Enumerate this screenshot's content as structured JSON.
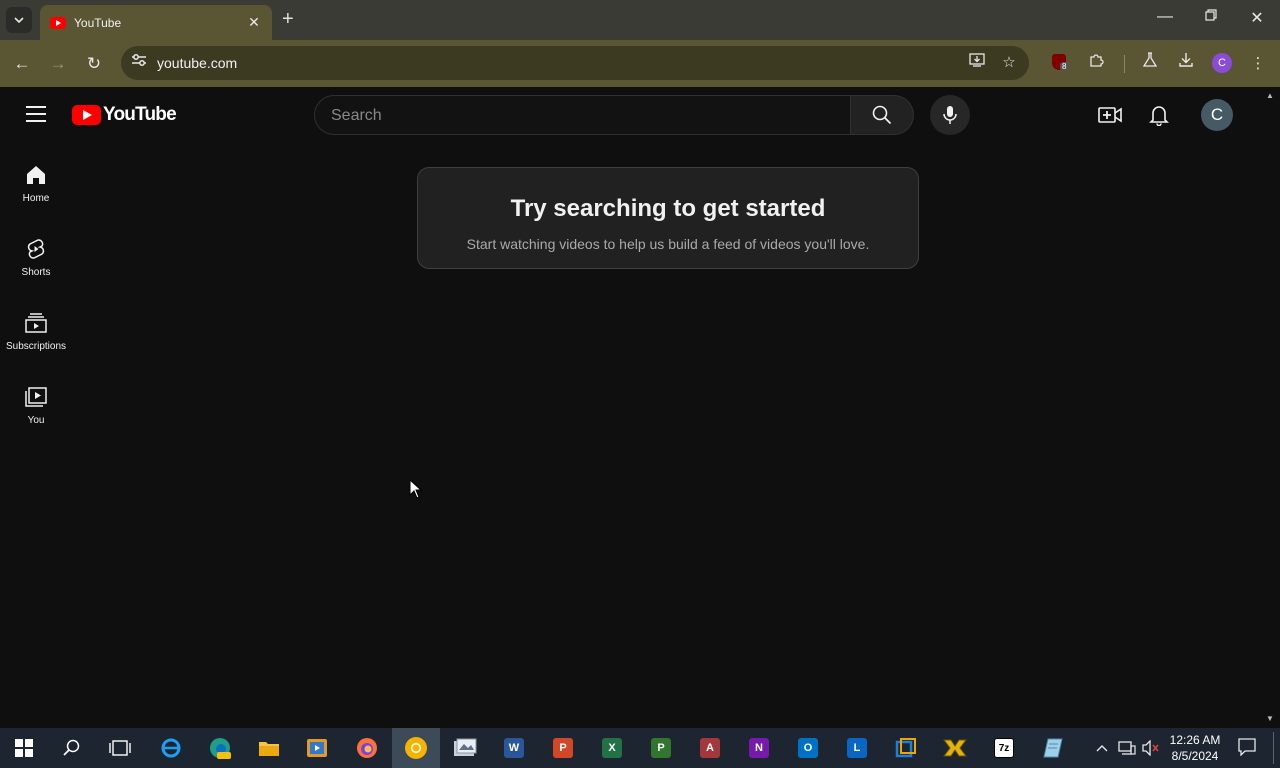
{
  "browser": {
    "tab_title": "YouTube",
    "url": "youtube.com",
    "profile_initial": "C",
    "extension_badge_count": "8"
  },
  "youtube": {
    "logo_text": "YouTube",
    "search_placeholder": "Search",
    "avatar_initial": "C",
    "sidebar": [
      {
        "label": "Home",
        "icon": "home-icon"
      },
      {
        "label": "Shorts",
        "icon": "shorts-icon"
      },
      {
        "label": "Subscriptions",
        "icon": "subscriptions-icon"
      },
      {
        "label": "You",
        "icon": "you-icon"
      }
    ],
    "prompt": {
      "title": "Try searching to get started",
      "subtitle": "Start watching videos to help us build a feed of videos you'll love."
    }
  },
  "taskbar": {
    "apps": [
      "start-icon",
      "search-icon",
      "task-view-icon",
      "internet-explorer-icon",
      "edge-canary-icon",
      "file-explorer-icon",
      "media-player-icon",
      "firefox-icon",
      "chrome-canary-icon",
      "photos-icon",
      "word-icon",
      "powerpoint-icon",
      "excel-icon",
      "project-icon",
      "access-icon",
      "onenote-icon",
      "outlook-icon",
      "lync-icon",
      "virtualbox-icon",
      "archiver-icon",
      "7zip-icon",
      "notepad-icon"
    ],
    "app_letters": {
      "word": "W",
      "powerpoint": "P",
      "excel": "X",
      "project": "P",
      "access": "A",
      "onenote": "N",
      "outlook": "O",
      "lync": "L",
      "sevenzip": "7z"
    },
    "time": "12:26 AM",
    "date": "8/5/2024"
  },
  "colors": {
    "youtube_red": "#ff0000",
    "chrome_frame": "#5a5634",
    "page_bg": "#0f0f0f",
    "taskbar_bg": "#1c2530"
  }
}
